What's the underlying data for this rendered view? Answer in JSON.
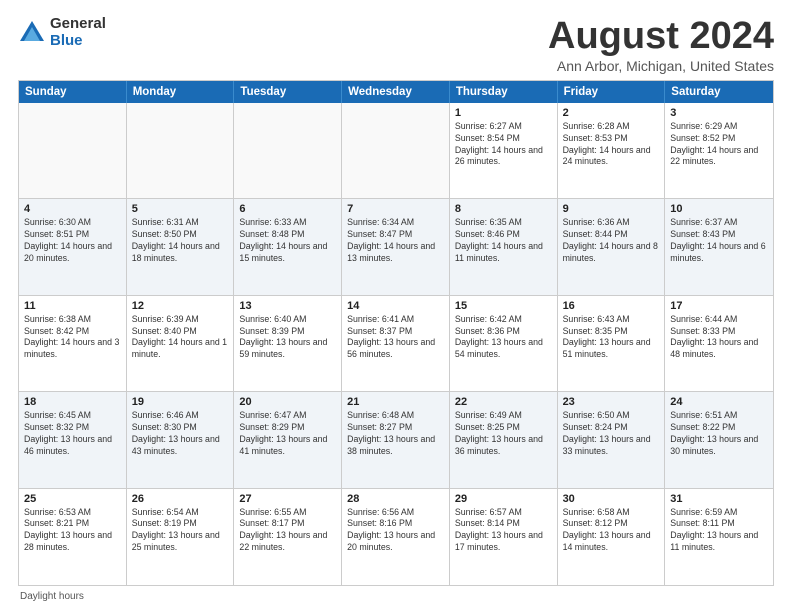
{
  "logo": {
    "general": "General",
    "blue": "Blue"
  },
  "title": "August 2024",
  "subtitle": "Ann Arbor, Michigan, United States",
  "header_days": [
    "Sunday",
    "Monday",
    "Tuesday",
    "Wednesday",
    "Thursday",
    "Friday",
    "Saturday"
  ],
  "footer": "Daylight hours",
  "weeks": [
    [
      {
        "day": "",
        "info": ""
      },
      {
        "day": "",
        "info": ""
      },
      {
        "day": "",
        "info": ""
      },
      {
        "day": "",
        "info": ""
      },
      {
        "day": "1",
        "info": "Sunrise: 6:27 AM\nSunset: 8:54 PM\nDaylight: 14 hours and 26 minutes."
      },
      {
        "day": "2",
        "info": "Sunrise: 6:28 AM\nSunset: 8:53 PM\nDaylight: 14 hours and 24 minutes."
      },
      {
        "day": "3",
        "info": "Sunrise: 6:29 AM\nSunset: 8:52 PM\nDaylight: 14 hours and 22 minutes."
      }
    ],
    [
      {
        "day": "4",
        "info": "Sunrise: 6:30 AM\nSunset: 8:51 PM\nDaylight: 14 hours and 20 minutes."
      },
      {
        "day": "5",
        "info": "Sunrise: 6:31 AM\nSunset: 8:50 PM\nDaylight: 14 hours and 18 minutes."
      },
      {
        "day": "6",
        "info": "Sunrise: 6:33 AM\nSunset: 8:48 PM\nDaylight: 14 hours and 15 minutes."
      },
      {
        "day": "7",
        "info": "Sunrise: 6:34 AM\nSunset: 8:47 PM\nDaylight: 14 hours and 13 minutes."
      },
      {
        "day": "8",
        "info": "Sunrise: 6:35 AM\nSunset: 8:46 PM\nDaylight: 14 hours and 11 minutes."
      },
      {
        "day": "9",
        "info": "Sunrise: 6:36 AM\nSunset: 8:44 PM\nDaylight: 14 hours and 8 minutes."
      },
      {
        "day": "10",
        "info": "Sunrise: 6:37 AM\nSunset: 8:43 PM\nDaylight: 14 hours and 6 minutes."
      }
    ],
    [
      {
        "day": "11",
        "info": "Sunrise: 6:38 AM\nSunset: 8:42 PM\nDaylight: 14 hours and 3 minutes."
      },
      {
        "day": "12",
        "info": "Sunrise: 6:39 AM\nSunset: 8:40 PM\nDaylight: 14 hours and 1 minute."
      },
      {
        "day": "13",
        "info": "Sunrise: 6:40 AM\nSunset: 8:39 PM\nDaylight: 13 hours and 59 minutes."
      },
      {
        "day": "14",
        "info": "Sunrise: 6:41 AM\nSunset: 8:37 PM\nDaylight: 13 hours and 56 minutes."
      },
      {
        "day": "15",
        "info": "Sunrise: 6:42 AM\nSunset: 8:36 PM\nDaylight: 13 hours and 54 minutes."
      },
      {
        "day": "16",
        "info": "Sunrise: 6:43 AM\nSunset: 8:35 PM\nDaylight: 13 hours and 51 minutes."
      },
      {
        "day": "17",
        "info": "Sunrise: 6:44 AM\nSunset: 8:33 PM\nDaylight: 13 hours and 48 minutes."
      }
    ],
    [
      {
        "day": "18",
        "info": "Sunrise: 6:45 AM\nSunset: 8:32 PM\nDaylight: 13 hours and 46 minutes."
      },
      {
        "day": "19",
        "info": "Sunrise: 6:46 AM\nSunset: 8:30 PM\nDaylight: 13 hours and 43 minutes."
      },
      {
        "day": "20",
        "info": "Sunrise: 6:47 AM\nSunset: 8:29 PM\nDaylight: 13 hours and 41 minutes."
      },
      {
        "day": "21",
        "info": "Sunrise: 6:48 AM\nSunset: 8:27 PM\nDaylight: 13 hours and 38 minutes."
      },
      {
        "day": "22",
        "info": "Sunrise: 6:49 AM\nSunset: 8:25 PM\nDaylight: 13 hours and 36 minutes."
      },
      {
        "day": "23",
        "info": "Sunrise: 6:50 AM\nSunset: 8:24 PM\nDaylight: 13 hours and 33 minutes."
      },
      {
        "day": "24",
        "info": "Sunrise: 6:51 AM\nSunset: 8:22 PM\nDaylight: 13 hours and 30 minutes."
      }
    ],
    [
      {
        "day": "25",
        "info": "Sunrise: 6:53 AM\nSunset: 8:21 PM\nDaylight: 13 hours and 28 minutes."
      },
      {
        "day": "26",
        "info": "Sunrise: 6:54 AM\nSunset: 8:19 PM\nDaylight: 13 hours and 25 minutes."
      },
      {
        "day": "27",
        "info": "Sunrise: 6:55 AM\nSunset: 8:17 PM\nDaylight: 13 hours and 22 minutes."
      },
      {
        "day": "28",
        "info": "Sunrise: 6:56 AM\nSunset: 8:16 PM\nDaylight: 13 hours and 20 minutes."
      },
      {
        "day": "29",
        "info": "Sunrise: 6:57 AM\nSunset: 8:14 PM\nDaylight: 13 hours and 17 minutes."
      },
      {
        "day": "30",
        "info": "Sunrise: 6:58 AM\nSunset: 8:12 PM\nDaylight: 13 hours and 14 minutes."
      },
      {
        "day": "31",
        "info": "Sunrise: 6:59 AM\nSunset: 8:11 PM\nDaylight: 13 hours and 11 minutes."
      }
    ]
  ]
}
